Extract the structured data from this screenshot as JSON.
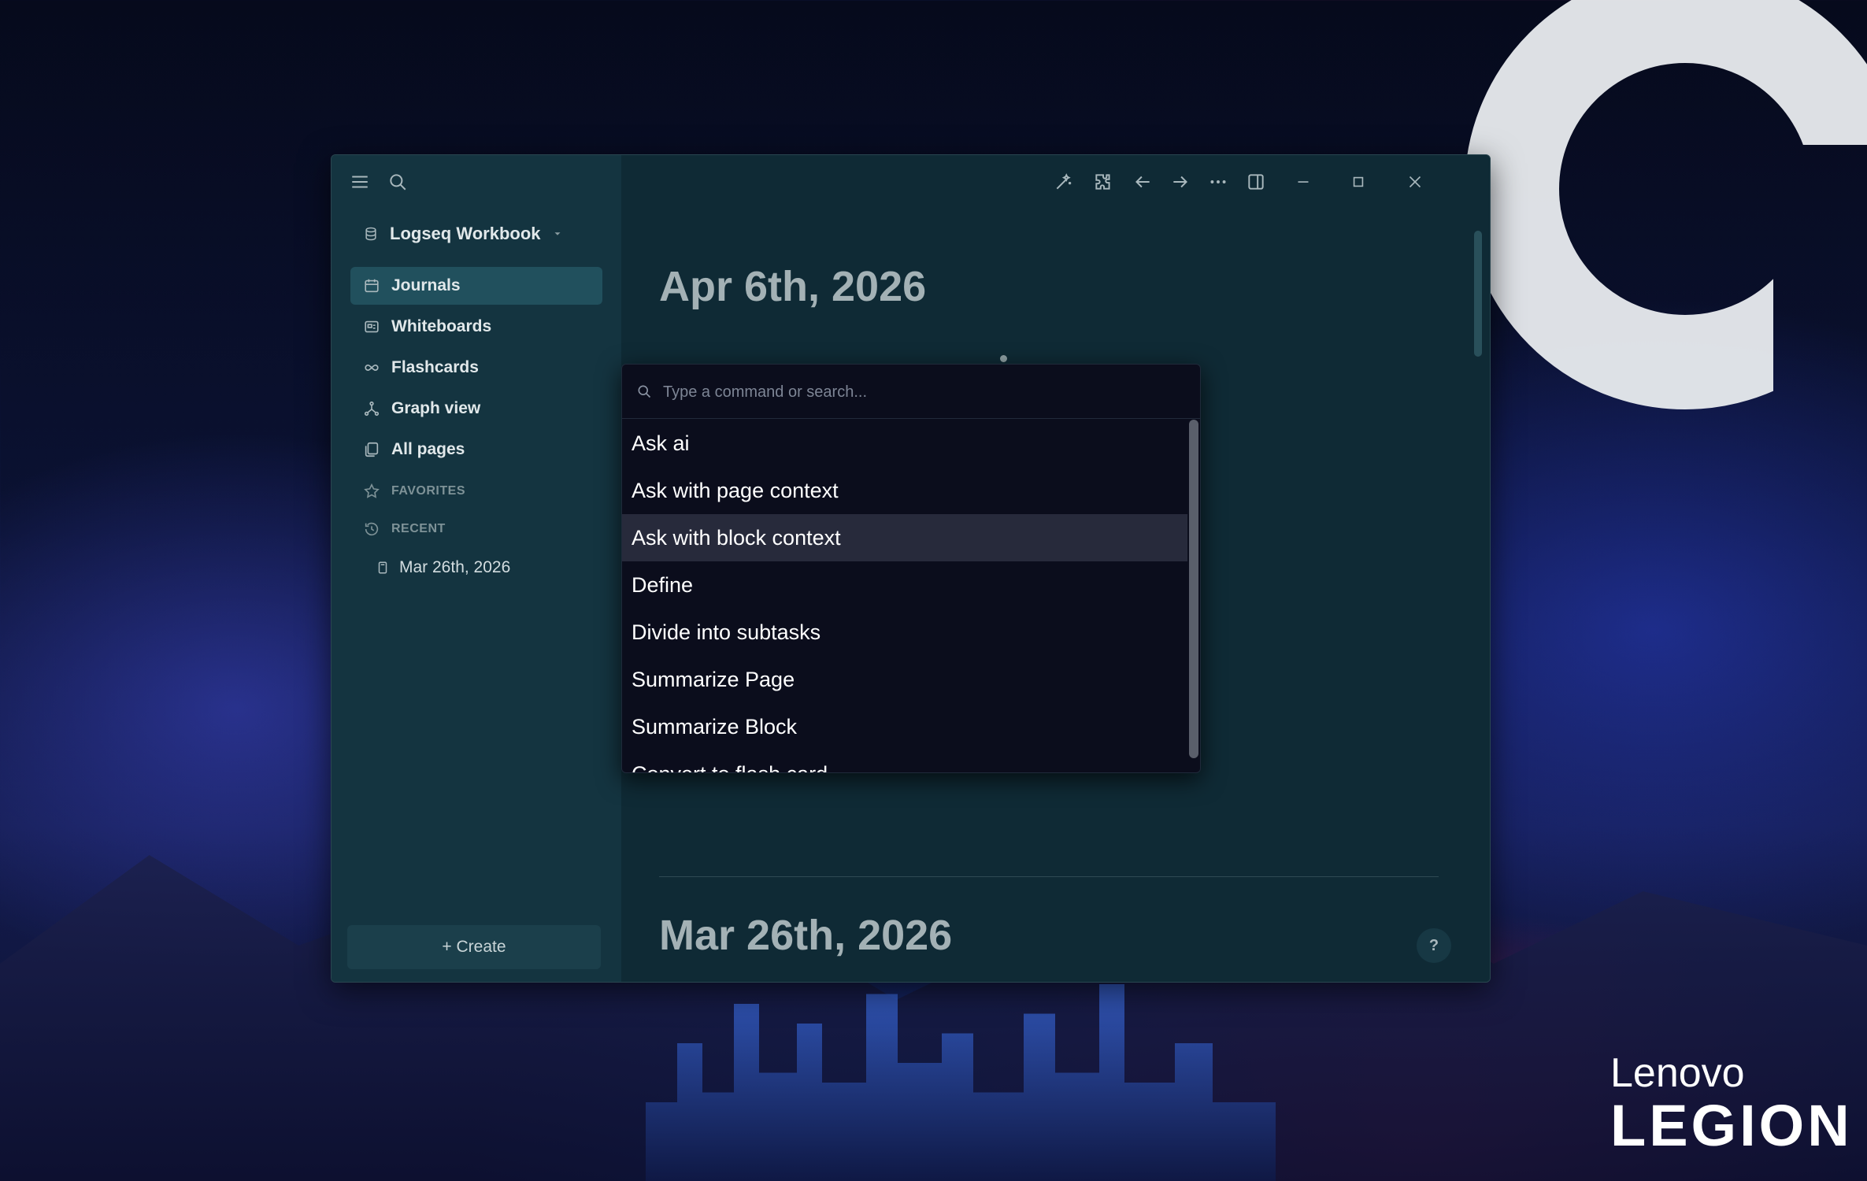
{
  "wallpaper": {
    "brand_top": "Lenovo",
    "brand_bottom": "LEGION"
  },
  "sidebar": {
    "graph_name": "Logseq Workbook",
    "nav": [
      {
        "label": "Journals",
        "icon": "calendar-icon",
        "active": true
      },
      {
        "label": "Whiteboards",
        "icon": "whiteboard-icon"
      },
      {
        "label": "Flashcards",
        "icon": "infinity-icon"
      },
      {
        "label": "Graph view",
        "icon": "graph-icon"
      },
      {
        "label": "All pages",
        "icon": "pages-icon"
      }
    ],
    "favorites_label": "FAVORITES",
    "recent_label": "RECENT",
    "recent_items": [
      "Mar 26th, 2026"
    ],
    "create_label": "+ Create"
  },
  "main": {
    "journals": [
      "Apr 6th, 2026",
      "Mar 26th, 2026"
    ],
    "help_label": "?"
  },
  "command_popup": {
    "placeholder": "Type a command or search...",
    "items": [
      "Ask ai",
      "Ask with page context",
      "Ask with block context",
      "Define",
      "Divide into subtasks",
      "Summarize Page",
      "Summarize Block",
      "Convert to flash card"
    ],
    "selected_index": 2
  },
  "colors": {
    "sidebar_bg": "#143440",
    "main_bg": "#0f2a35",
    "active_nav_bg": "#21505d",
    "popup_bg": "#0b0d1c",
    "popup_selected_bg": "#272a3b"
  }
}
